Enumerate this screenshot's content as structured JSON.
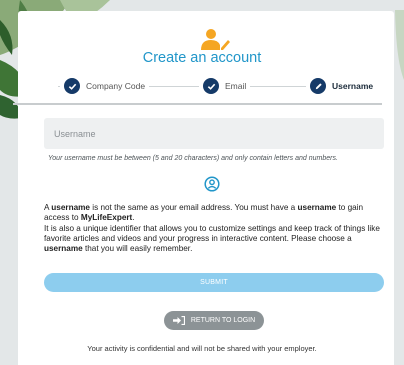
{
  "header": {
    "title": "Create an account",
    "icon": "user-edit-icon",
    "icon_color": "#f5a623"
  },
  "steps": [
    {
      "label": "Company Code",
      "icon": "check-icon",
      "state": "completed"
    },
    {
      "label": "Email",
      "icon": "check-icon",
      "state": "completed"
    },
    {
      "label": "Username",
      "icon": "pencil-icon",
      "state": "active"
    }
  ],
  "form": {
    "username_placeholder": "Username",
    "username_value": "",
    "hint": "Your username must be between (5 and 20 characters) and only contain letters and numbers.",
    "submit_label": "SUBMIT"
  },
  "info": {
    "line1_pre": "A ",
    "line1_bold1": "username",
    "line1_mid": " is not the same as your email address. You must have a ",
    "line1_bold2": "username",
    "line1_post": " to gain access to ",
    "line1_bold3": "MyLifeExpert",
    "line1_end": ".",
    "line2": "It is also a unique identifier that allows you to customize settings and keep track of things like favorite articles and videos and your progress in interactive content. Please choose a ",
    "line2_bold": "username",
    "line2_end": " that you will easily remember."
  },
  "return_label": "RETURN TO LOGIN",
  "footer": "Your activity is confidential and will not be shared with your employer.",
  "colors": {
    "accent": "#2196c9",
    "step_circle": "#153a68",
    "submit_bg": "#8dcdee",
    "return_bg": "#8c9396",
    "leaf": "#3e7a3c"
  }
}
